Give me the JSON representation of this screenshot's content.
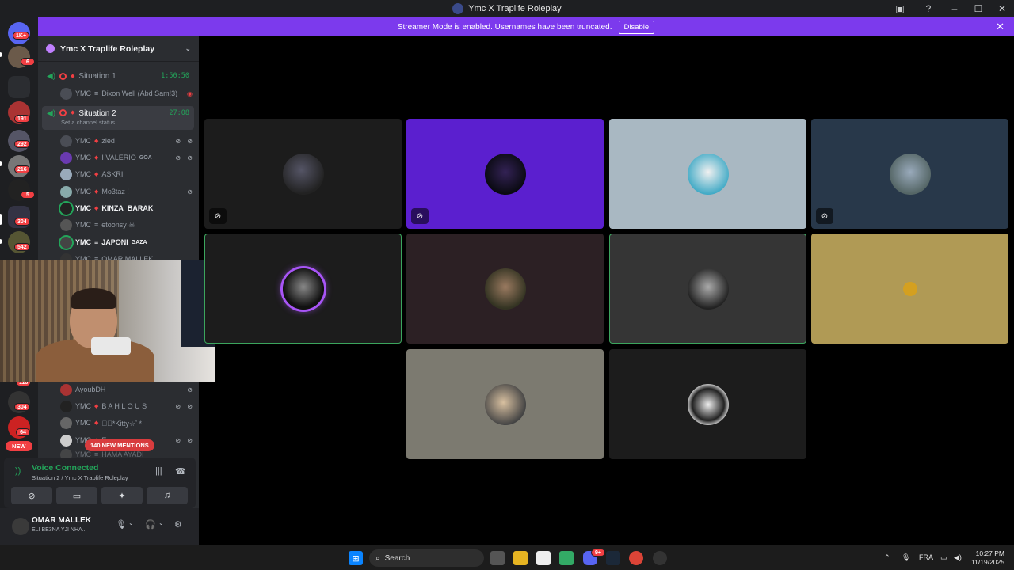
{
  "window": {
    "title": "Ymc X Traplife Roleplay"
  },
  "banner": {
    "text": "Streamer Mode is enabled. Usernames have been truncated.",
    "disable_label": "Disable"
  },
  "rail": {
    "badges": [
      "1K+",
      "6",
      "191",
      "292",
      "216",
      "5",
      "304",
      "542",
      "116",
      "304",
      "64"
    ],
    "new_label": "NEW"
  },
  "server": {
    "name": "Ymc X Traplife Roleplay"
  },
  "channels": [
    {
      "name": "Situation 1",
      "time": "1:50:50"
    },
    {
      "name": "Situation 2",
      "time": "27:08",
      "status": "Set a channel status"
    }
  ],
  "members": {
    "situation1": [
      {
        "prefix": "YMC",
        "sep": "≡",
        "name": "Dixon Well (Abd Sam!3)"
      }
    ],
    "situation2": [
      {
        "prefix": "YMC",
        "sep": "◆",
        "name": "zied"
      },
      {
        "prefix": "YMC",
        "sep": "◆",
        "name": "I VALERIO",
        "tag": "GOA"
      },
      {
        "prefix": "YMC",
        "sep": "◆",
        "name": "ASKRI"
      },
      {
        "prefix": "YMC",
        "sep": "◆",
        "name": "Mo3taz !"
      },
      {
        "prefix": "YMC",
        "sep": "◆",
        "name": "KINZA_BARAK"
      },
      {
        "prefix": "YMC",
        "sep": "≡",
        "name": "etoonsy ☠"
      },
      {
        "prefix": "YMC",
        "sep": "≡",
        "name": "JAPONI",
        "tag": "GAZA"
      },
      {
        "prefix": "YMC",
        "sep": "≡",
        "name": "OMAR MALLEK"
      },
      {
        "prefix": "",
        "sep": "",
        "name": "AyoubDH"
      },
      {
        "prefix": "YMC",
        "sep": "◆",
        "name": "B A H L O U S"
      },
      {
        "prefix": "YMC",
        "sep": "◆",
        "name": "☆ﾟ*Kitty☆ﾟ*"
      },
      {
        "prefix": "YMC",
        "sep": "◆",
        "name": "E_____"
      },
      {
        "prefix": "YMC",
        "sep": "≡",
        "name": "HAMA AYADI"
      }
    ]
  },
  "mentions": {
    "label": "140 NEW MENTIONS"
  },
  "voice": {
    "title": "Voice Connected",
    "subtitle": "Situation 2 / Ymc X Traplife Roleplay"
  },
  "user": {
    "name": "OMAR MALLEK",
    "status": "ELI BE3NA YJI NHA..."
  },
  "taskbar": {
    "search_placeholder": "Search",
    "discord_badge": "9+",
    "lang": "FRA",
    "time": "10:27 PM",
    "date": "11/19/2025"
  },
  "colors": {
    "accent": "#7c3aed",
    "online": "#23a55a",
    "danger": "#f23f43"
  }
}
